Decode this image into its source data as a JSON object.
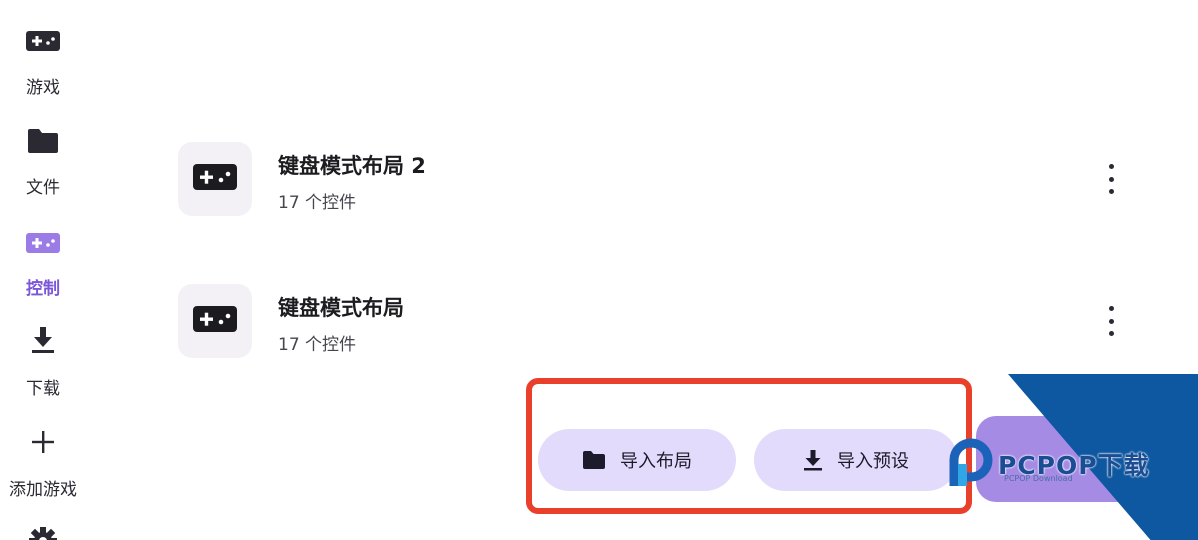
{
  "sidebar": {
    "items": [
      {
        "label": "游戏",
        "icon": "gamepad-icon",
        "active": false
      },
      {
        "label": "文件",
        "icon": "folder-icon",
        "active": false
      },
      {
        "label": "控制",
        "icon": "gamepad-icon",
        "active": true
      },
      {
        "label": "下载",
        "icon": "download-icon",
        "active": false
      },
      {
        "label": "添加游戏",
        "icon": "plus-icon",
        "active": false
      }
    ],
    "partial_icon": "settings-icon"
  },
  "layouts": [
    {
      "title": "键盘模式布局 2",
      "subtitle": "17 个控件",
      "icon": "gamepad-icon"
    },
    {
      "title": "键盘模式布局",
      "subtitle": "17 个控件",
      "icon": "gamepad-icon"
    }
  ],
  "actions": {
    "import_layout": {
      "label": "导入布局",
      "icon": "folder-icon"
    },
    "import_preset": {
      "label": "导入预设",
      "icon": "download-icon"
    }
  },
  "watermark": {
    "text": "PCPOP下载",
    "sub": "PCPOP Download"
  },
  "colors": {
    "accent": "#7c56d8",
    "pill_background": "#e3dbfb",
    "highlight_border": "#e8402b",
    "watermark_blue": "#0d58a1"
  }
}
